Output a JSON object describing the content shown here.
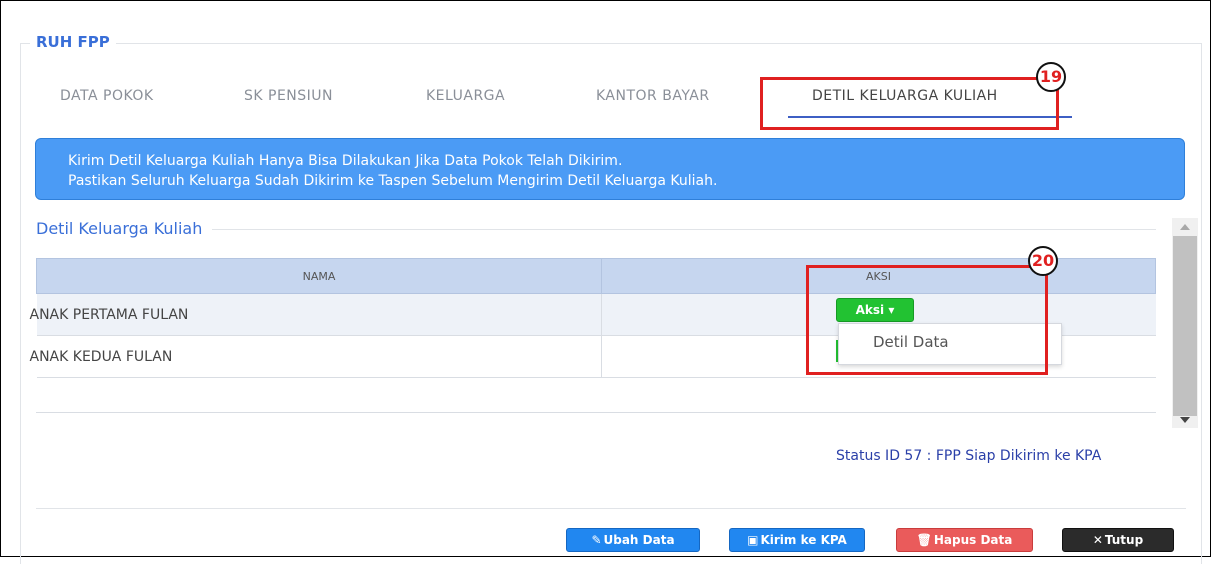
{
  "panel": {
    "legend": "RUH FPP"
  },
  "tabs": [
    {
      "label": "DATA POKOK"
    },
    {
      "label": "SK PENSIUN"
    },
    {
      "label": "KELUARGA"
    },
    {
      "label": "KANTOR BAYAR"
    },
    {
      "label": "DETIL KELUARGA KULIAH"
    }
  ],
  "callouts": {
    "tab": "19",
    "aksi": "20"
  },
  "info": {
    "line1": "Kirim Detil Keluarga Kuliah Hanya Bisa Dilakukan Jika Data Pokok Telah Dikirim.",
    "line2": "Pastikan Seluruh Keluarga Sudah Dikirim ke Taspen Sebelum Mengirim Detil Keluarga Kuliah."
  },
  "section": {
    "title": "Detil Keluarga Kuliah"
  },
  "table": {
    "headers": [
      "NAMA",
      "AKSI"
    ],
    "rows": [
      {
        "nama": "ANAK PERTAMA FULAN"
      },
      {
        "nama": "ANAK KEDUA FULAN"
      }
    ]
  },
  "aksi": {
    "button_label": "Aksi ▾",
    "menu_item": "Detil Data"
  },
  "status": {
    "text": "Status ID 57 : FPP Siap Dikirim ke KPA"
  },
  "buttons": {
    "ubah": "Ubah Data",
    "kirim": "Kirim ke KPA",
    "hapus": "Hapus Data",
    "tutup": "Tutup"
  },
  "colors": {
    "accent": "#3a6fd8",
    "info_bg": "#4b9bf5",
    "aksi_green": "#22c232",
    "callout_red": "#e02020"
  }
}
